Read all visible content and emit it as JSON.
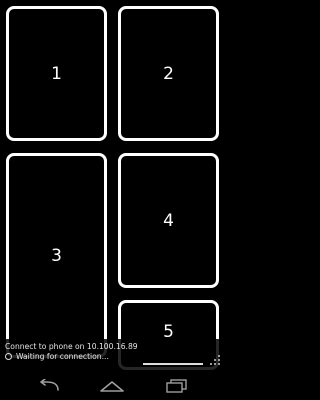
{
  "tiles": [
    {
      "label": "1"
    },
    {
      "label": "2"
    },
    {
      "label": "3"
    },
    {
      "label": "4"
    },
    {
      "label": "5"
    }
  ],
  "status": {
    "connect_message": "Connect to phone on 10.100.16.89",
    "waiting_message": "Waiting for connection..."
  },
  "nav_icons": {
    "back": "back-arrow-icon",
    "home": "home-icon",
    "recents": "recent-apps-icon"
  },
  "colors": {
    "background": "#000000",
    "tile_border": "#ffffff",
    "nav_icon": "#9e9e9e"
  }
}
